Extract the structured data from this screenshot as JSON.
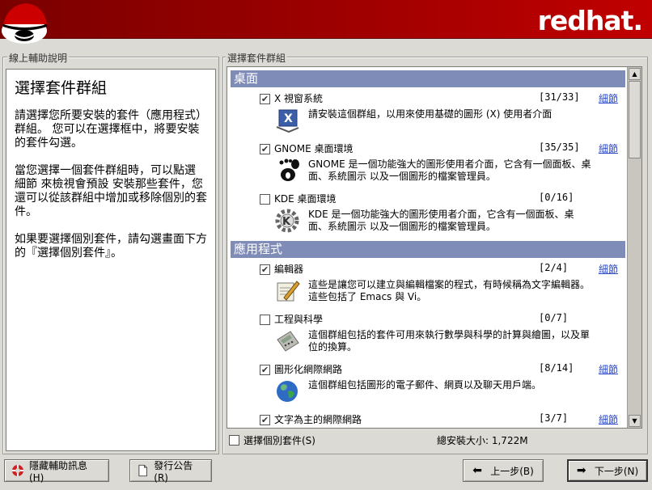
{
  "banner": {
    "brand": "redhat."
  },
  "help": {
    "frame_label": "線上輔助說明",
    "title": "選擇套件群組",
    "paragraphs": [
      "請選擇您所要安裝的套件（應用程式）群組。 您可以在選擇框中，將要安裝的套件勾選。",
      "當您選擇一個套件群組時，可以點選 細節 來檢視會預設 安裝那些套件，您還可以從該群組中增加或移除個別的套件。",
      "如果要選擇個別套件，請勾選畫面下方的『選擇個別套件』。"
    ]
  },
  "packages": {
    "frame_label": "選擇套件群組",
    "categories": [
      {
        "label": "桌面",
        "groups": [
          {
            "name": "X 視窗系統",
            "count": "[31/33]",
            "checked": true,
            "details": "細節",
            "icon": "x-window-icon",
            "desc": "請安裝這個群組，以用來使用基礎的圖形 (X) 使用者介面"
          },
          {
            "name": "GNOME 桌面環境",
            "count": "[35/35]",
            "checked": true,
            "details": "細節",
            "icon": "gnome-icon",
            "desc": "GNOME 是一個功能強大的圖形使用者介面，它含有一個面板、桌面、系統圖示 以及一個圖形的檔案管理員。"
          },
          {
            "name": "KDE 桌面環境",
            "count": "[0/16]",
            "checked": false,
            "details": "",
            "icon": "kde-icon",
            "desc": "KDE 是一個功能強大的圖形使用者介面，它含有一個面板、桌面、系統圖示 以及一個圖形的檔案管理員。"
          }
        ]
      },
      {
        "label": "應用程式",
        "groups": [
          {
            "name": "編輯器",
            "count": "[2/4]",
            "checked": true,
            "details": "細節",
            "icon": "editor-icon",
            "desc": "這些是讓您可以建立與編輯檔案的程式，有時候稱為文字編輯器。 這些包括了 Emacs 與 Vi。"
          },
          {
            "name": "工程與科學",
            "count": "[0/7]",
            "checked": false,
            "details": "",
            "icon": "calculator-icon",
            "desc": "這個群組包括的套件可用來執行數學與科學的計算與繪圖，以及單位的換算。"
          },
          {
            "name": "圖形化網際網路",
            "count": "[8/14]",
            "checked": true,
            "details": "細節",
            "icon": "globe-icon",
            "desc": "這個群組包括圖形的電子郵件、網頁以及聊天用戶端。"
          },
          {
            "name": "文字為主的網際網路",
            "count": "[3/7]",
            "checked": true,
            "details": "細節",
            "icon": "text-internet-icon",
            "desc": ""
          }
        ]
      }
    ]
  },
  "bottom": {
    "individual_label": "選擇個別套件(S)",
    "total_size": "總安裝大小: 1,722M"
  },
  "buttons": {
    "hide_help": "隱藏輔助訊息(H)",
    "release_notes": "發行公告(R)",
    "back": "上一步(B)",
    "next": "下一步(N)"
  }
}
